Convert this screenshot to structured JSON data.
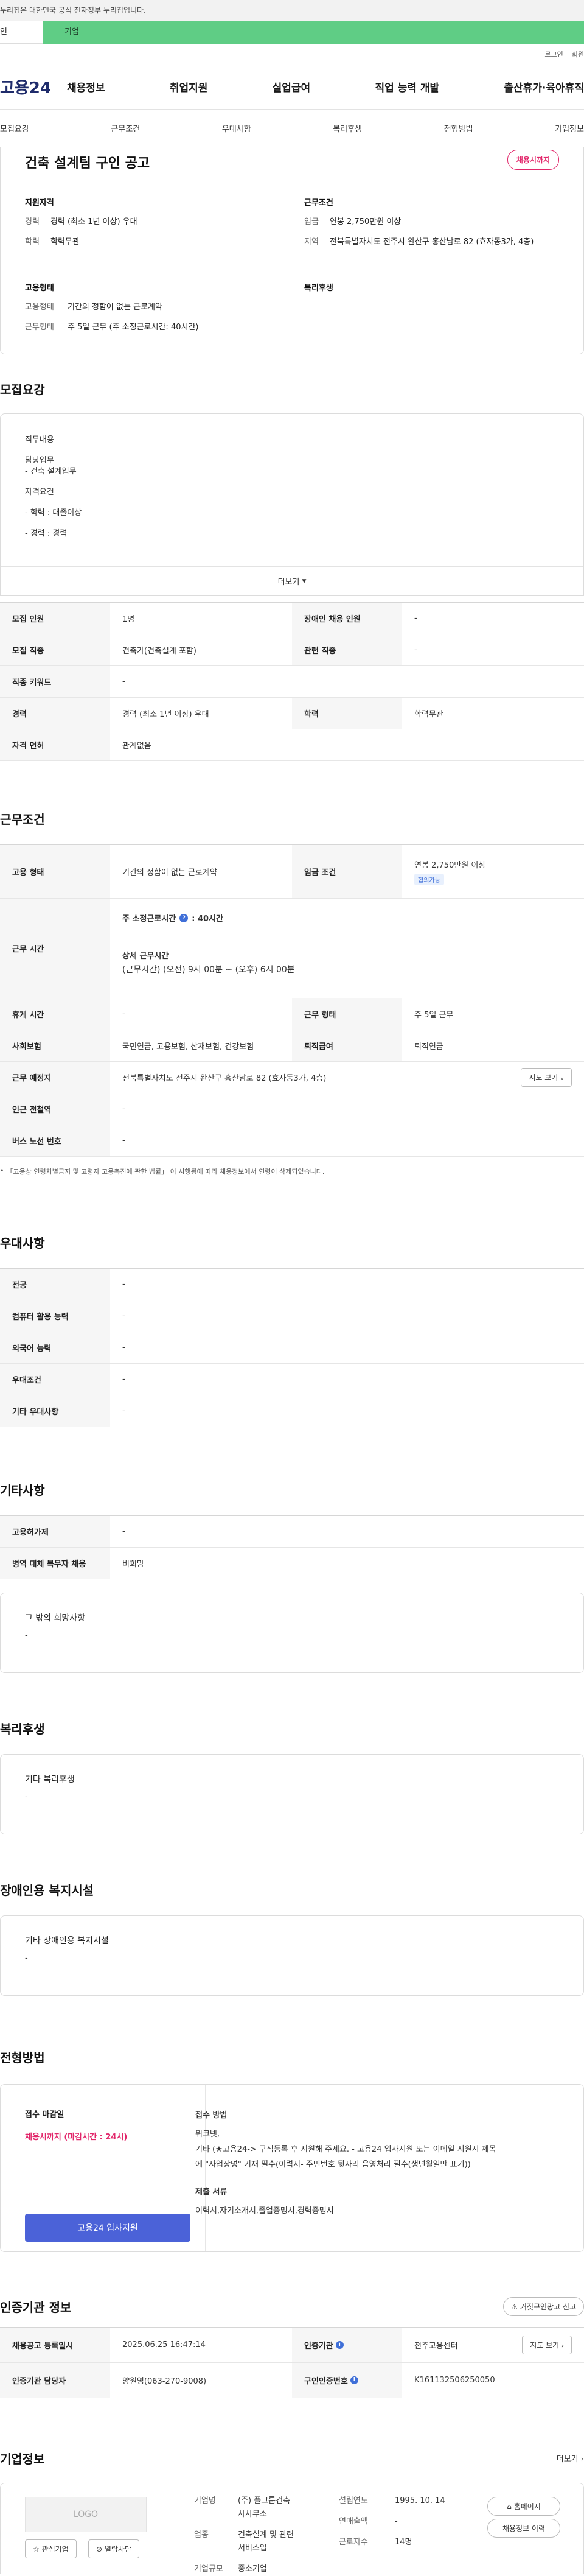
{
  "gov_notice": "누리집은 대한민국 공식 전자정부 누리집입니다.",
  "tabs": {
    "personal": "인",
    "company": "기업"
  },
  "util": {
    "login": "로그인",
    "signup": "회원"
  },
  "logo": "고용24",
  "gnb": [
    "채용정보",
    "취업지원",
    "실업급여",
    "직업 능력 개발",
    "출산휴가·육아휴직"
  ],
  "subnav": [
    "모집요강",
    "근무조건",
    "우대사항",
    "복리후생",
    "전형방법",
    "기업정보"
  ],
  "summary": {
    "title": "건축 설계팀 구인 공고",
    "status": "채용시까지",
    "qual_title": "지원자격",
    "qual": [
      {
        "k": "경력",
        "v": "경력 (최소 1년 이상) 우대"
      },
      {
        "k": "학력",
        "v": "학력무관"
      }
    ],
    "work_title": "근무조건",
    "work": [
      {
        "k": "임금",
        "v": "연봉 2,750만원 이상"
      },
      {
        "k": "지역",
        "v": "전북특별자치도 전주시 완산구 홍산남로 82 (효자동3가, 4층)"
      }
    ],
    "emp_title": "고용형태",
    "emp": [
      {
        "k": "고용형태",
        "v": "기간의 정함이 없는 근로계약"
      },
      {
        "k": "근무형태",
        "v": "주 5일 근무 (주 소정근로시간: 40시간)"
      }
    ],
    "welfare_title": "복리후생"
  },
  "recruit": {
    "title": "모집요강",
    "duty_label": "직무내용",
    "duty_head": "담당업무",
    "duty_item": "- 건축 설계업무",
    "qual_head": "자격요건",
    "qual_items": [
      "- 학력 : 대졸이상",
      "- 경력 : 경력"
    ],
    "more": "더보기",
    "rows": [
      [
        {
          "th": "모집 인원",
          "td": "1명"
        },
        {
          "th": "장애인 채용 인원",
          "td": "-"
        }
      ],
      [
        {
          "th": "모집 직종",
          "td": "건축가(건축설계 포함)"
        },
        {
          "th": "관련 직종",
          "td": "-"
        }
      ],
      [
        {
          "th": "직종 키워드",
          "td": "-"
        }
      ],
      [
        {
          "th": "경력",
          "td": "경력 (최소 1년 이상) 우대"
        },
        {
          "th": "학력",
          "td": "학력무관"
        }
      ],
      [
        {
          "th": "자격 면허",
          "td": "관계없음"
        }
      ]
    ]
  },
  "conditions": {
    "title": "근무조건",
    "emp_type_th": "고용 형태",
    "emp_type_td": "기간의 정함이 없는 근로계약",
    "wage_th": "임금 조건",
    "wage_td": "연봉 2,750만원 이상",
    "wage_badge": "협의가능",
    "hours_th": "근무 시간",
    "hours_weekly": "주 소정근로시간",
    "hours_weekly_value": ": 40시간",
    "hours_detail_label": "상세 근무시간",
    "hours_detail": "(근무시간) (오전) 9시 00분 ~ (오후) 6시 00분",
    "rest_th": "휴게 시간",
    "rest_td": "-",
    "form_th": "근무 형태",
    "form_td": "주 5일 근무",
    "ins_th": "사회보험",
    "ins_td": "국민연금, 고용보험, 산재보험, 건강보험",
    "sev_th": "퇴직급여",
    "sev_td": "퇴직연금",
    "loc_th": "근무 예정지",
    "loc_td": "전북특별자치도 전주시 완산구 홍산남로 82 (효자동3가, 4층)",
    "map_btn": "지도 보기",
    "subway_th": "인근 전철역",
    "subway_td": "-",
    "bus_th": "버스 노선 번호",
    "bus_td": "-",
    "notice": "「고용상 연령차별금지 및 고령자 고용촉진에 관한 법률」 이 시행됨에 따라 채용정보에서 연령이 삭제되었습니다."
  },
  "prefer": {
    "title": "우대사항",
    "rows": [
      {
        "th": "전공",
        "td": "-"
      },
      {
        "th": "컴퓨터 활용 능력",
        "td": "-"
      },
      {
        "th": "외국어 능력",
        "td": "-"
      },
      {
        "th": "우대조건",
        "td": "-"
      },
      {
        "th": "기타 우대사항",
        "td": "-"
      }
    ]
  },
  "etc": {
    "title": "기타사항",
    "rows": [
      {
        "th": "고용허가제",
        "td": "-"
      },
      {
        "th": "병역 대체 복무자 채용",
        "td": "비희망"
      }
    ],
    "card_title": "그 밖의 희망사항",
    "card_body": "-"
  },
  "welfare": {
    "title": "복리후생",
    "card_title": "기타 복리후생",
    "card_body": "-"
  },
  "disability": {
    "title": "장애인용 복지시설",
    "card_title": "기타 장애인용 복지시설",
    "card_body": "-"
  },
  "selection": {
    "title": "전형방법",
    "deadline_label": "접수 마감일",
    "deadline_value": "채용시까지 (마감시간 : 24시)",
    "apply_btn": "고용24 입사지원",
    "method_label": "접수 방법",
    "method_lines": [
      "워크넷,",
      "기타 (★고용24-> 구직등록 후 지원해 주세요. - 고용24 입사지원 또는 이메일 지원시 제목",
      "에 \"사업장명\" 기재 필수(이력서- 주민번호 뒷자리 음영처리 필수(생년월일만 표기))"
    ],
    "docs_label": "제출 서류",
    "docs_value": "이력서,자기소개서,졸업증명서,경력증명서"
  },
  "cert": {
    "title": "인증기관 정보",
    "report_btn": "거짓구인광고 신고",
    "reg_th": "채용공고 등록일시",
    "reg_td": "2025.06.25 16:47:14",
    "org_th": "인증기관",
    "org_td": "전주고용센터",
    "map_btn": "지도 보기",
    "mgr_th": "인증기관 담당자",
    "mgr_td": "양원영(063-270-9008)",
    "num_th": "구인인증번호",
    "num_td": "K161132506250050"
  },
  "company": {
    "title": "기업정보",
    "more": "더보기",
    "logo_text": "LOGO",
    "fav_btn": "관심기업",
    "block_btn": "열람차단",
    "name_k": "기업명",
    "name_v1": "(주) 플그룹건축",
    "name_v2": "사사무소",
    "industry_k": "업종",
    "industry_v1": "건축설계 및 관련",
    "industry_v2": "서비스업",
    "size_k": "기업규모",
    "size_v": "중소기업",
    "founded_k": "설립연도",
    "founded_v": "1995. 10. 14",
    "revenue_k": "연매출액",
    "revenue_v": "-",
    "employees_k": "근로자수",
    "employees_v": "14명",
    "home_btn": "홈페이지",
    "history_btn": "채용정보 이력"
  }
}
